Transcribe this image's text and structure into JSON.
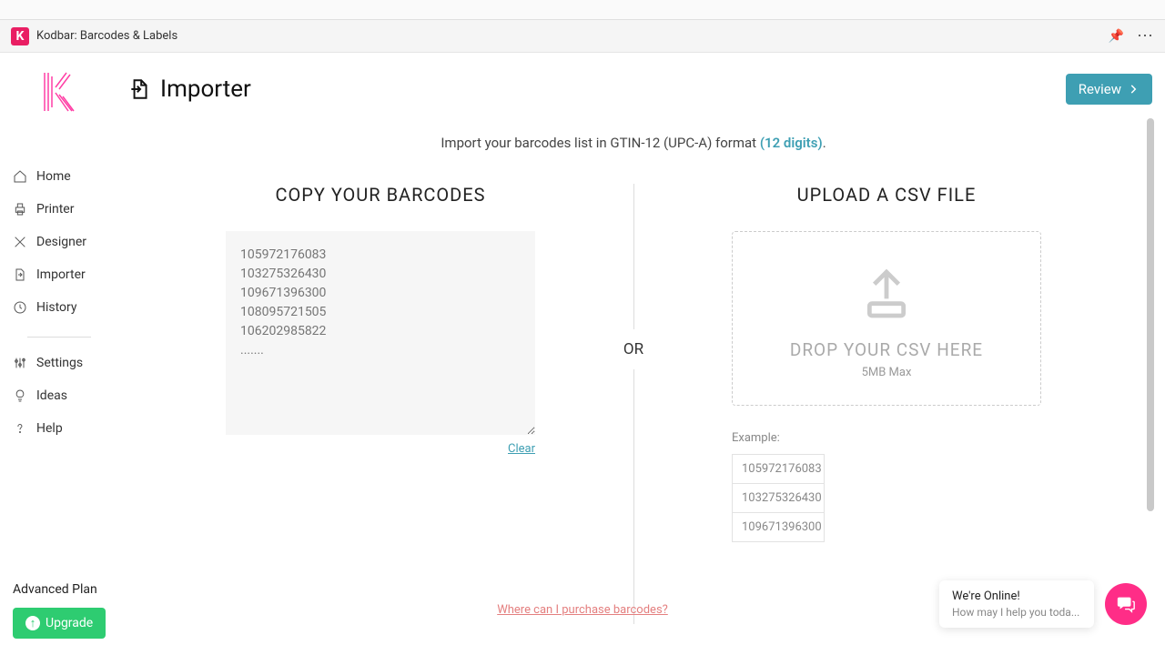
{
  "appbar": {
    "brand_initial": "K",
    "brand_title": "Kodbar: Barcodes & Labels"
  },
  "sidebar": {
    "items": [
      {
        "label": "Home"
      },
      {
        "label": "Printer"
      },
      {
        "label": "Designer"
      },
      {
        "label": "Importer"
      },
      {
        "label": "History"
      }
    ],
    "items2": [
      {
        "label": "Settings"
      },
      {
        "label": "Ideas"
      },
      {
        "label": "Help"
      }
    ],
    "plan_label": "Advanced Plan",
    "upgrade_label": "Upgrade"
  },
  "header": {
    "title": "Importer",
    "review_label": "Review"
  },
  "main": {
    "intro_pre": "Import your barcodes list in GTIN-12 (UPC-A) format ",
    "intro_digits": "(12 digits)",
    "intro_post": ".",
    "copy_heading": "COPY YOUR BARCODES",
    "upload_heading": "UPLOAD A CSV FILE",
    "or_label": "OR",
    "textarea_placeholder": "105972176083\n103275326430\n109671396300\n108095721505\n106202985822\n.......",
    "clear_label": "Clear",
    "drop_text": "DROP YOUR CSV HERE",
    "drop_sub": "5MB Max",
    "example_label": "Example:",
    "example_rows": [
      "105972176083",
      "103275326430",
      "109671396300"
    ],
    "purchase_link": "Where can I purchase barcodes?"
  },
  "chat": {
    "title": "We're Online!",
    "sub": "How may I help you toda..."
  }
}
